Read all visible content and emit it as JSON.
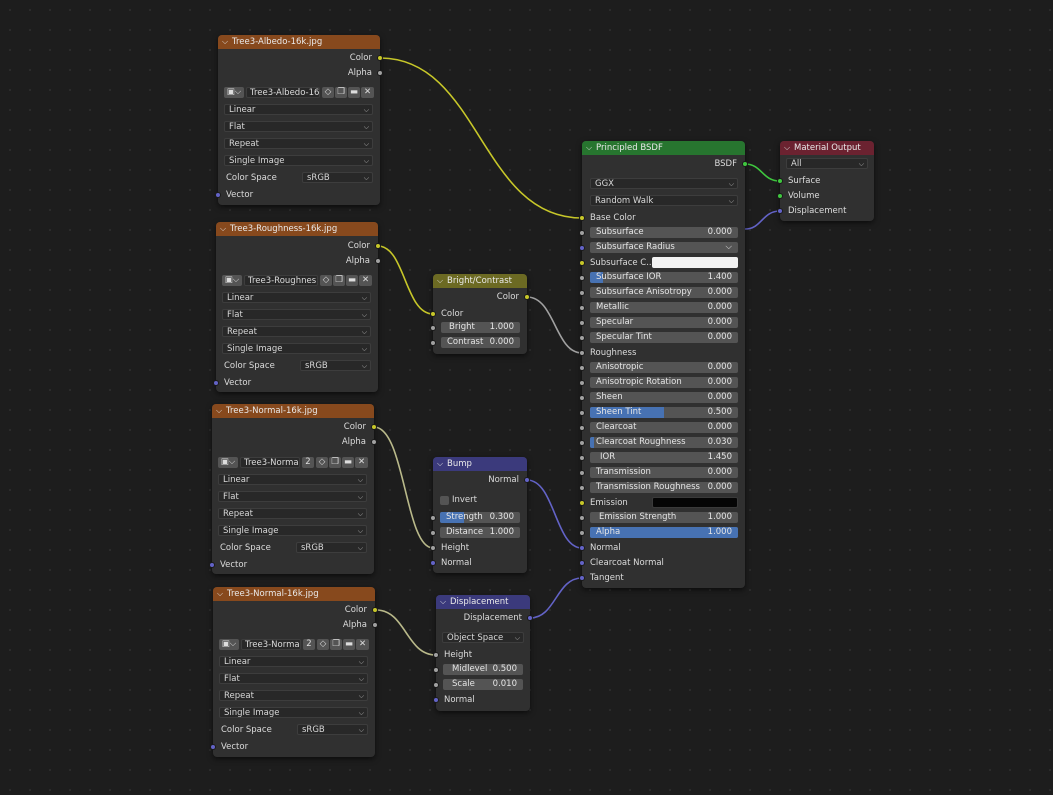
{
  "colors": {
    "texture_header": "#87491d",
    "shader_header": "#27752f",
    "color_header": "#6c6a23",
    "vector_header": "#3b3a7c",
    "output_header": "#6b2230",
    "socket_yellow": "#c7c729",
    "socket_grey": "#a1a1a1",
    "socket_blue": "#6363c7",
    "socket_green": "#3fc73f",
    "accent": "#4772b3"
  },
  "albedo": {
    "title": "Tree3-Albedo-16k.jpg",
    "out_color": "Color",
    "out_alpha": "Alpha",
    "image_name": "Tree3-Albedo-16...",
    "interpolation": "Linear",
    "projection": "Flat",
    "extension": "Repeat",
    "source": "Single Image",
    "color_space_label": "Color Space",
    "color_space": "sRGB",
    "vector": "Vector"
  },
  "roughness": {
    "title": "Tree3-Roughness-16k.jpg",
    "out_color": "Color",
    "out_alpha": "Alpha",
    "image_name": "Tree3-Roughnes...",
    "interpolation": "Linear",
    "projection": "Flat",
    "extension": "Repeat",
    "source": "Single Image",
    "color_space_label": "Color Space",
    "color_space": "sRGB",
    "vector": "Vector"
  },
  "normal1": {
    "title": "Tree3-Normal-16k.jpg",
    "out_color": "Color",
    "out_alpha": "Alpha",
    "image_name": "Tree3-Norma...",
    "users": "2",
    "interpolation": "Linear",
    "projection": "Flat",
    "extension": "Repeat",
    "source": "Single Image",
    "color_space_label": "Color Space",
    "color_space": "sRGB",
    "vector": "Vector"
  },
  "normal2": {
    "title": "Tree3-Normal-16k.jpg",
    "out_color": "Color",
    "out_alpha": "Alpha",
    "image_name": "Tree3-Norma...",
    "users": "2",
    "interpolation": "Linear",
    "projection": "Flat",
    "extension": "Repeat",
    "source": "Single Image",
    "color_space_label": "Color Space",
    "color_space": "sRGB",
    "vector": "Vector"
  },
  "brightcontrast": {
    "title": "Bright/Contrast",
    "out_color": "Color",
    "in_color": "Color",
    "bright_label": "Bright",
    "bright_value": "1.000",
    "contrast_label": "Contrast",
    "contrast_value": "0.000"
  },
  "bump": {
    "title": "Bump",
    "out_normal": "Normal",
    "invert": "Invert",
    "strength_label": "Strength",
    "strength_value": "0.300",
    "strength_fraction": 0.3,
    "distance_label": "Distance",
    "distance_value": "1.000",
    "in_height": "Height",
    "in_normal": "Normal"
  },
  "displacement": {
    "title": "Displacement",
    "out": "Displacement",
    "space": "Object Space",
    "in_height": "Height",
    "midlevel_label": "Midlevel",
    "midlevel_value": "0.500",
    "scale_label": "Scale",
    "scale_value": "0.010",
    "in_normal": "Normal"
  },
  "bsdf": {
    "title": "Principled BSDF",
    "out": "BSDF",
    "distribution": "GGX",
    "subsurface_method": "Random Walk",
    "base_color": "Base Color",
    "subsurface": {
      "label": "Subsurface",
      "value": "0.000"
    },
    "subsurface_radius": "Subsurface Radius",
    "subsurface_color": "Subsurface C...",
    "subsurface_ior": {
      "label": "Subsurface IOR",
      "value": "1.400",
      "fraction": 0.09
    },
    "subsurface_anisotropy": {
      "label": "Subsurface Anisotropy",
      "value": "0.000"
    },
    "metallic": {
      "label": "Metallic",
      "value": "0.000"
    },
    "specular": {
      "label": "Specular",
      "value": "0.000"
    },
    "specular_tint": {
      "label": "Specular Tint",
      "value": "0.000"
    },
    "roughness": "Roughness",
    "anisotropic": {
      "label": "Anisotropic",
      "value": "0.000"
    },
    "anisotropic_rotation": {
      "label": "Anisotropic Rotation",
      "value": "0.000"
    },
    "sheen": {
      "label": "Sheen",
      "value": "0.000"
    },
    "sheen_tint": {
      "label": "Sheen Tint",
      "value": "0.500",
      "fraction": 0.5
    },
    "clearcoat": {
      "label": "Clearcoat",
      "value": "0.000"
    },
    "clearcoat_roughness": {
      "label": "Clearcoat Roughness",
      "value": "0.030",
      "fraction": 0.03
    },
    "ior": {
      "label": "IOR",
      "value": "1.450"
    },
    "transmission": {
      "label": "Transmission",
      "value": "0.000"
    },
    "transmission_roughness": {
      "label": "Transmission Roughness",
      "value": "0.000"
    },
    "emission": "Emission",
    "emission_strength": {
      "label": "Emission Strength",
      "value": "1.000"
    },
    "alpha": {
      "label": "Alpha",
      "value": "1.000",
      "fraction": 1.0
    },
    "normal": "Normal",
    "clearcoat_normal": "Clearcoat Normal",
    "tangent": "Tangent"
  },
  "output": {
    "title": "Material Output",
    "target": "All",
    "surface": "Surface",
    "volume": "Volume",
    "displacement": "Displacement"
  }
}
